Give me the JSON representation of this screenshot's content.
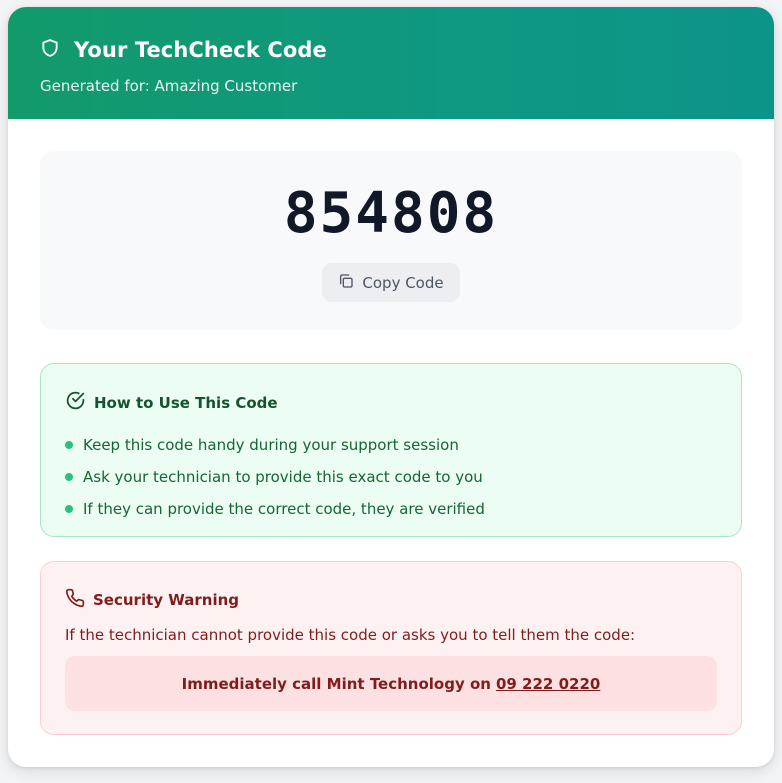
{
  "header": {
    "title": "Your TechCheck Code",
    "subtitle": "Generated for: Amazing Customer"
  },
  "code": {
    "value": "854808",
    "copy_label": "Copy Code"
  },
  "how_to": {
    "title": "How to Use This Code",
    "steps": [
      "Keep this code handy during your support session",
      "Ask your technician to provide this exact code to you",
      "If they can provide the correct code, they are verified"
    ]
  },
  "warning": {
    "title": "Security Warning",
    "text": "If the technician cannot provide this code or asks you to tell them the code:",
    "call_prefix": "Immediately call Mint Technology on",
    "phone": "09 222 0220"
  },
  "colors": {
    "header_gradient_start": "#129a6b",
    "header_gradient_end": "#0d9488",
    "success_bg": "#ecfdf3",
    "danger_bg": "#fef1f2"
  },
  "icons": {
    "header": "shield-icon",
    "copy": "copy-icon",
    "how_to": "check-circle-icon",
    "warning": "phone-icon"
  }
}
